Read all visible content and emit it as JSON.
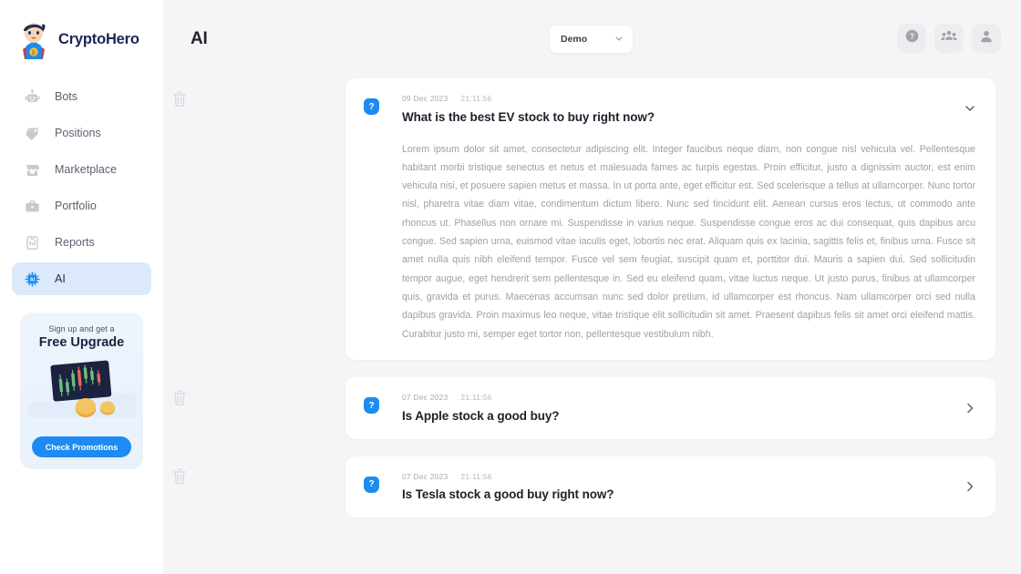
{
  "brand": {
    "name": "CryptoHero",
    "logo_icon": "hero-avatar-logo",
    "accent": "#1d8bf1",
    "title_color": "#1b2559"
  },
  "sidebar": {
    "items": [
      {
        "label": "Bots",
        "icon": "robot-icon",
        "active": false
      },
      {
        "label": "Positions",
        "icon": "tag-icon",
        "active": false
      },
      {
        "label": "Marketplace",
        "icon": "store-icon",
        "active": false
      },
      {
        "label": "Portfolio",
        "icon": "briefcase-icon",
        "active": false
      },
      {
        "label": "Reports",
        "icon": "report-icon",
        "active": false
      },
      {
        "label": "AI",
        "icon": "chip-ai-icon",
        "active": true
      }
    ],
    "promo": {
      "subtitle": "Sign up and get a",
      "title": "Free Upgrade",
      "art_icon": "candlestick-chart-coins-art",
      "button_label": "Check Promotions",
      "button_color": "#1d8bf1"
    }
  },
  "header": {
    "title": "AI",
    "account_selector": {
      "value": "Demo",
      "icon": "chevron-down-icon"
    },
    "actions": [
      {
        "name": "help-button",
        "icon": "question-circle-icon"
      },
      {
        "name": "community-button",
        "icon": "people-group-icon"
      },
      {
        "name": "profile-button",
        "icon": "user-icon"
      }
    ]
  },
  "conversations": [
    {
      "date": "09 Dec 2023",
      "time": "21:11:56",
      "question": "What is the best EV stock to buy right now?",
      "expanded": true,
      "chevron": "chevron-down-icon",
      "answer": "Lorem ipsum dolor sit amet, consectetur adipiscing elit. Integer faucibus neque diam, non congue nisl vehicula vel. Pellentesque habitant morbi tristique senectus et netus et malesuada fames ac turpis egestas. Proin efficitur, justo a dignissim auctor, est enim vehicula nisi, et posuere sapien metus et massa. In ut porta ante, eget efficitur est. Sed scelerisque a tellus at ullamcorper. Nunc tortor nisl, pharetra vitae diam vitae, condimentum dictum libero. Nunc sed tincidunt elit. Aenean cursus eros lectus, ut commodo ante rhoncus ut. Phasellus non ornare mi. Suspendisse in varius neque. Suspendisse congue eros ac dui consequat, quis dapibus arcu congue. Sed sapien urna, euismod vitae iaculis eget, lobortis nec erat. Aliquam quis ex lacinia, sagittis felis et, finibus urna. Fusce sit amet nulla quis nibh eleifend tempor. Fusce vel sem feugiat, suscipit quam et, porttitor dui. Mauris a sapien dui. Sed sollicitudin tempor augue, eget hendrerit sem pellentesque in. Sed eu eleifend quam, vitae luctus neque. Ut justo purus, finibus at ullamcorper quis, gravida et purus. Maecenas accumsan nunc sed dolor pretium, id ullamcorper est rhoncus. Nam ullamcorper orci sed nulla dapibus gravida. Proin maximus leo neque, vitae tristique elit sollicitudin sit amet. Praesent dapibus felis sit amet orci eleifend mattis. Curabitur justo mi, semper eget tortor non, pellentesque vestibulum nibh."
    },
    {
      "date": "07 Dec 2023",
      "time": "21:11:56",
      "question": "Is Apple stock a good buy?",
      "expanded": false,
      "chevron": "chevron-right-icon",
      "answer": ""
    },
    {
      "date": "07 Dec 2023",
      "time": "21:11:56",
      "question": "Is Tesla stock a good buy right now?",
      "expanded": false,
      "chevron": "chevron-right-icon",
      "answer": ""
    }
  ],
  "icons": {
    "delete": "trash-icon",
    "question_badge": "question-mark-badge"
  }
}
